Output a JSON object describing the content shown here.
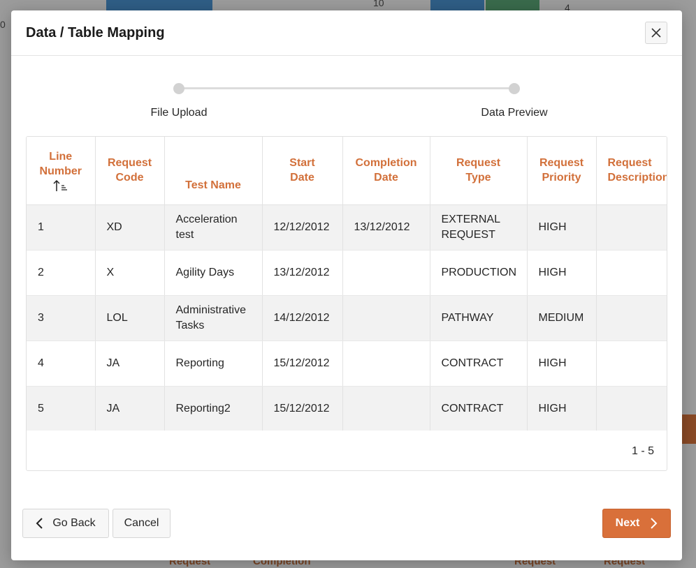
{
  "dialog": {
    "title": "Data / Table Mapping"
  },
  "wizard": {
    "steps": [
      {
        "label": "File Upload"
      },
      {
        "label": "Data Preview"
      }
    ]
  },
  "table": {
    "columns": [
      [
        "Line",
        "Number"
      ],
      [
        "Request",
        "Code"
      ],
      [
        "Test Name"
      ],
      [
        "Start",
        "Date"
      ],
      [
        "Completion",
        "Date"
      ],
      [
        "Request",
        "Type"
      ],
      [
        "Request",
        "Priority"
      ],
      [
        "Request",
        "Description"
      ]
    ],
    "rows": [
      [
        "1",
        "XD",
        "Acceleration test",
        "12/12/2012",
        "13/12/2012",
        "EXTERNAL REQUEST",
        "HIGH",
        ""
      ],
      [
        "2",
        "X",
        "Agility Days",
        "13/12/2012",
        "",
        "PRODUCTION",
        "HIGH",
        ""
      ],
      [
        "3",
        "LOL",
        "Administrative Tasks",
        "14/12/2012",
        "",
        "PATHWAY",
        "MEDIUM",
        ""
      ],
      [
        "4",
        "JA",
        "Reporting",
        "15/12/2012",
        "",
        "CONTRACT",
        "HIGH",
        ""
      ],
      [
        "5",
        "JA",
        "Reporting2",
        "15/12/2012",
        "",
        "CONTRACT",
        "HIGH",
        ""
      ]
    ],
    "pagination": "1 - 5",
    "sort_icon": "sort-ascending-icon"
  },
  "footer": {
    "back_label": "Go Back",
    "cancel_label": "Cancel",
    "next_label": "Next"
  },
  "background": {
    "fragments": [
      "10",
      "4",
      "0",
      "Request",
      "Completion",
      "Request",
      "Request"
    ]
  },
  "colors": {
    "accent": "#d9703a",
    "header_text": "#d2703a",
    "row_stripe": "#f2f2f2"
  }
}
